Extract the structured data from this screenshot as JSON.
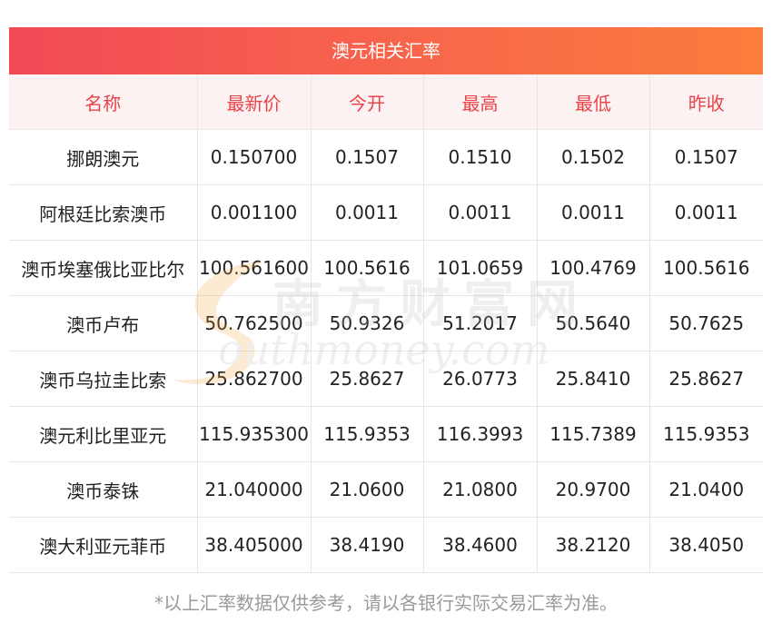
{
  "header": {
    "title": "澳元相关汇率"
  },
  "table": {
    "columns": [
      "名称",
      "最新价",
      "今开",
      "最高",
      "最低",
      "昨收"
    ],
    "rows": [
      [
        "挪朗澳元",
        "0.150700",
        "0.1507",
        "0.1510",
        "0.1502",
        "0.1507"
      ],
      [
        "阿根廷比索澳币",
        "0.001100",
        "0.0011",
        "0.0011",
        "0.0011",
        "0.0011"
      ],
      [
        "澳币埃塞俄比亚比尔",
        "100.561600",
        "100.5616",
        "101.0659",
        "100.4769",
        "100.5616"
      ],
      [
        "澳币卢布",
        "50.762500",
        "50.9326",
        "51.2017",
        "50.5640",
        "50.7625"
      ],
      [
        "澳币乌拉圭比索",
        "25.862700",
        "25.8627",
        "26.0773",
        "25.8410",
        "25.8627"
      ],
      [
        "澳元利比里亚元",
        "115.935300",
        "115.9353",
        "116.3993",
        "115.7389",
        "115.9353"
      ],
      [
        "澳币泰铢",
        "21.040000",
        "21.0600",
        "21.0800",
        "20.9700",
        "21.0400"
      ],
      [
        "澳大利亚元菲币",
        "38.405000",
        "38.4190",
        "38.4600",
        "38.2120",
        "38.4050"
      ]
    ]
  },
  "watermark": {
    "cn": "南方财富网",
    "en": "outhmoney.com"
  },
  "footnote": "*以上汇率数据仅供参考，请以各银行实际交易汇率为准。",
  "colors": {
    "header_gradient_start": "#f14a56",
    "header_gradient_end": "#fb7d3c",
    "column_header_text": "#e8434a",
    "column_header_bg": "#fdf2f2"
  }
}
